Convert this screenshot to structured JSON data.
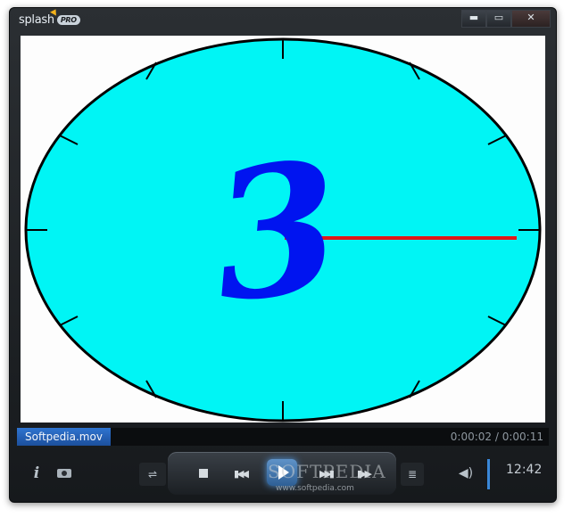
{
  "app": {
    "logo_text": "splash",
    "logo_badge": "PRO"
  },
  "window_controls": {
    "minimize": "▬",
    "maximize": "▭",
    "close": "✕"
  },
  "video": {
    "clock_numeral": "3",
    "colors": {
      "face": "#00f5f5",
      "numeral": "#0014f0",
      "hand": "#e01818",
      "ticks": "#000000"
    }
  },
  "info_bar": {
    "filename": "Softpedia.mov",
    "timecode": "0:00:02 / 0:00:11"
  },
  "controls": {
    "info_label": "i",
    "clock_time": "12:42",
    "watermark": "SOFTPEDIA",
    "watermark_url": "www.softpedia.com",
    "icons": [
      "info-icon",
      "camera-icon",
      "equalizer-icon",
      "stop-icon",
      "previous-icon",
      "play-icon",
      "next-icon",
      "frame-step-icon",
      "playlist-icon",
      "volume-icon"
    ]
  }
}
